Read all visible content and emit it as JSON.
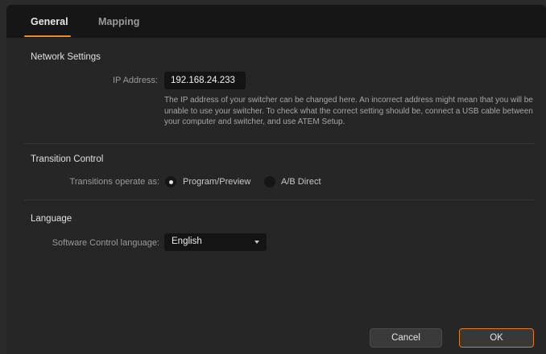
{
  "tabs": [
    {
      "label": "General",
      "active": true
    },
    {
      "label": "Mapping",
      "active": false
    }
  ],
  "network": {
    "title": "Network Settings",
    "ip_label": "IP Address:",
    "ip_value": "192.168.24.233",
    "help": "The IP address of your switcher can be changed here. An incorrect address might mean that you will be unable to use your switcher. To check what the correct setting should be, connect a USB cable between your computer and switcher, and use ATEM Setup."
  },
  "transition": {
    "title": "Transition Control",
    "label": "Transitions operate as:",
    "options": [
      {
        "label": "Program/Preview",
        "selected": true
      },
      {
        "label": "A/B Direct",
        "selected": false
      }
    ]
  },
  "language": {
    "title": "Language",
    "label": "Software Control language:",
    "selected": "English"
  },
  "buttons": {
    "cancel": "Cancel",
    "ok": "OK"
  },
  "colors": {
    "accent": "#f08a24",
    "background": "#262626",
    "tabbar": "#161616"
  }
}
